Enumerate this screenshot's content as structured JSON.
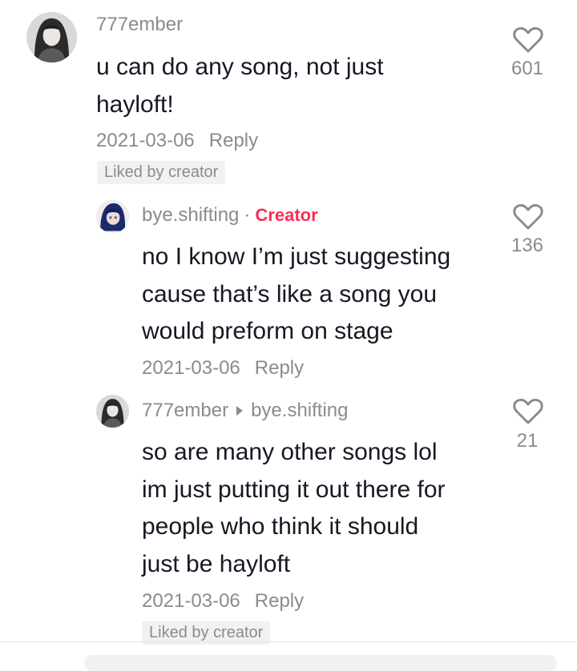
{
  "comments": [
    {
      "username": "777ember",
      "lines": [
        "u can do any song, not just",
        "hayloft!"
      ],
      "date": "2021-03-06",
      "reply_label": "Reply",
      "liked_label": "Liked by creator",
      "likes": "601",
      "avatar_icon": "avatar-dark-hair-icon"
    },
    {
      "username": "bye.shifting",
      "separator": "·",
      "creator_label": "Creator",
      "lines": [
        "no I know I’m just suggesting",
        "cause that’s like a song you",
        "would preform on stage"
      ],
      "date": "2021-03-06",
      "reply_label": "Reply",
      "likes": "136",
      "avatar_icon": "avatar-blue-hair-icon"
    },
    {
      "username": "777ember",
      "reply_to": "bye.shifting",
      "lines": [
        "so are many other songs lol",
        "im just putting it out there for",
        "people who think it should",
        "just be hayloft"
      ],
      "date": "2021-03-06",
      "reply_label": "Reply",
      "liked_label": "Liked by creator",
      "likes": "21",
      "avatar_icon": "avatar-dark-hair-icon"
    }
  ],
  "colors": {
    "text": "#161823",
    "secondary": "#8a8b91",
    "creator": "#fe2c55",
    "badge_bg": "#f1f1f2"
  }
}
